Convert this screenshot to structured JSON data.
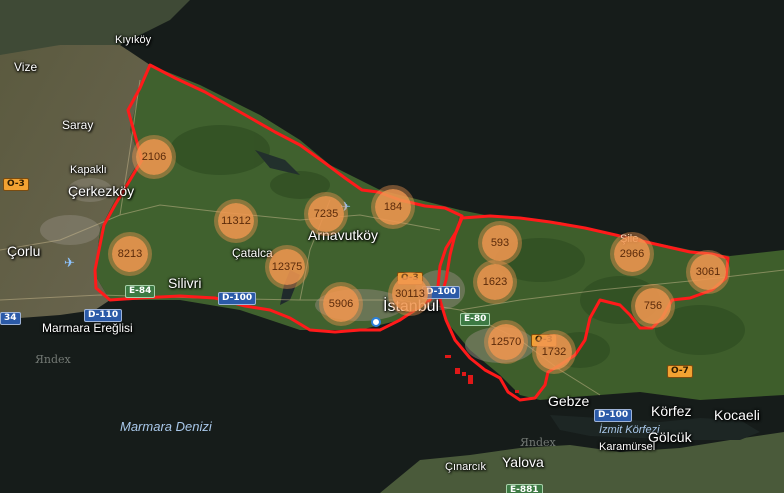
{
  "map": {
    "water_labels": {
      "marmara": "Marmara Denizi",
      "izmit_gulf": "İzmit Körfezi"
    },
    "watermark": "Яndex",
    "place_labels": {
      "kiyikoy": "Kıyıköy",
      "vize": "Vize",
      "saray": "Saray",
      "kapakli": "Kapaklı",
      "cerkezkoy": "Çerkezköy",
      "corlu": "Çorlu",
      "silivri": "Silivri",
      "catalca": "Çatalca",
      "arnavutkoy": "Arnavutköy",
      "istanbul": "İstanbul",
      "marmara_ereglisi": "Marmara Ereğlisi",
      "gebze": "Gebze",
      "korfez": "Körfez",
      "kocaeli": "Kocaeli",
      "golcuk": "Gölcük",
      "karamursel": "Karamürsel",
      "yalova": "Yalova",
      "cinarcik": "Çınarcık",
      "sile": "Şile"
    },
    "road_shields": {
      "o3_west": "O-3",
      "o3_center": "O-3",
      "o7": "O-7",
      "o3_east": "O-3",
      "d110": "D-110",
      "d100_west": "D-100",
      "d100_center": "D-100",
      "d100_east": "D-100",
      "e84": "E-84",
      "e80": "E-80",
      "e881": "E-881",
      "n34": "34"
    },
    "clusters": [
      "2106",
      "11312",
      "7235",
      "184",
      "8213",
      "12375",
      "5906",
      "30113",
      "593",
      "1623",
      "2966",
      "3061",
      "756",
      "12570",
      "1732"
    ],
    "colors": {
      "cluster": "#f09650",
      "boundary": "#ff1a1a",
      "land": "#3a5a2a",
      "sea": "#161c1a"
    }
  }
}
